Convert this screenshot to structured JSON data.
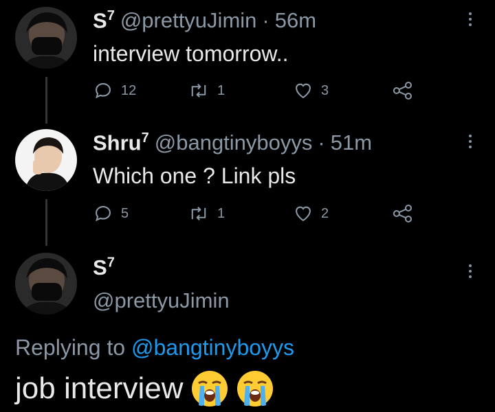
{
  "tweets": [
    {
      "name": "S",
      "name_sup": "7",
      "handle": "@prettyuJimin",
      "sep": "·",
      "time": "56m",
      "text": "interview tomorrow..",
      "replies": "12",
      "retweets": "1",
      "likes": "3"
    },
    {
      "name": "Shru",
      "name_sup": "7",
      "handle": "@bangtinyboyys",
      "sep": "·",
      "time": "51m",
      "text": "Which one ? Link pls",
      "replies": "5",
      "retweets": "1",
      "likes": "2"
    }
  ],
  "focused": {
    "name": "S",
    "name_sup": "7",
    "handle": "@prettyuJimin",
    "replying_prefix": "Replying to",
    "replying_handle": "@bangtinyboyys",
    "text": "job interview"
  },
  "colors": {
    "background": "#000000",
    "text": "#e7e9ea",
    "muted": "#8b98a5",
    "accent": "#1d9bf0"
  },
  "icons": [
    "reply-icon",
    "retweet-icon",
    "like-icon",
    "share-icon",
    "more-icon",
    "loudly-crying-face-emoji"
  ]
}
